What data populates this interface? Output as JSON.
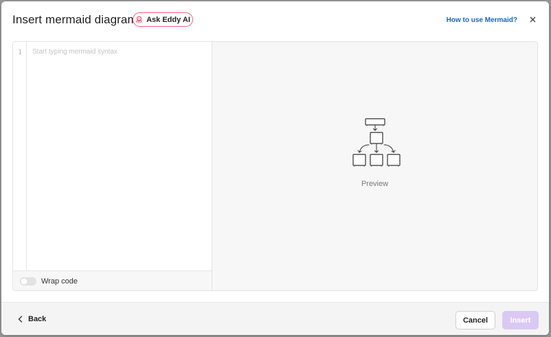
{
  "dialog": {
    "title": "Insert mermaid diagram",
    "ai_button_label": "Ask Eddy AI",
    "help_link": "How to use Mermaid?",
    "close_symbol": "×"
  },
  "editor": {
    "line_number": "1",
    "value": "",
    "placeholder": "Start typing mermaid syntax",
    "wrap_label": "Wrap code",
    "wrap_enabled": false
  },
  "preview": {
    "label": "Preview",
    "icon": "flowchart-icon"
  },
  "footer": {
    "back_label": "Back",
    "cancel_label": "Cancel",
    "insert_label": "Insert"
  },
  "colors": {
    "ai_border": "#f0607a",
    "link": "#1565c0",
    "insert_disabled": "#d9c9f3"
  }
}
